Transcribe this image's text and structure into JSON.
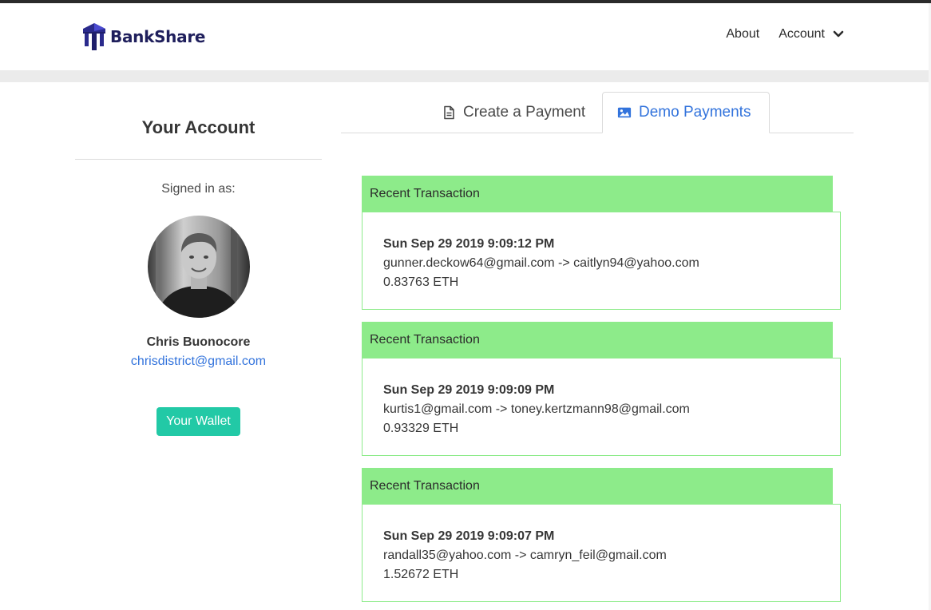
{
  "app": {
    "name": "BankShare"
  },
  "nav": {
    "about": "About",
    "account": "Account"
  },
  "sidebar": {
    "title": "Your Account",
    "signed_in_label": "Signed in as:",
    "user_name": "Chris Buonocore",
    "user_email": "chrisdistrict@gmail.com",
    "wallet_button": "Your Wallet"
  },
  "tabs": [
    {
      "label": "Create a Payment",
      "icon": "file-icon",
      "active": false
    },
    {
      "label": "Demo Payments",
      "icon": "image-icon",
      "active": true
    }
  ],
  "transactions": [
    {
      "header": "Recent Transaction",
      "date": "Sun Sep 29 2019 9:09:12 PM",
      "parties": "gunner.deckow64@gmail.com -> caitlyn94@yahoo.com",
      "amount": "0.83763 ETH"
    },
    {
      "header": "Recent Transaction",
      "date": "Sun Sep 29 2019 9:09:09 PM",
      "parties": "kurtis1@gmail.com -> toney.kertzmann98@gmail.com",
      "amount": "0.93329 ETH"
    },
    {
      "header": "Recent Transaction",
      "date": "Sun Sep 29 2019 9:09:07 PM",
      "parties": "randall35@yahoo.com -> camryn_feil@gmail.com",
      "amount": "1.52672 ETH"
    }
  ],
  "colors": {
    "brand": "#1f1f5c",
    "link": "#3273dc",
    "wallet": "#22c9a6",
    "txn_header": "#8deb8a"
  }
}
